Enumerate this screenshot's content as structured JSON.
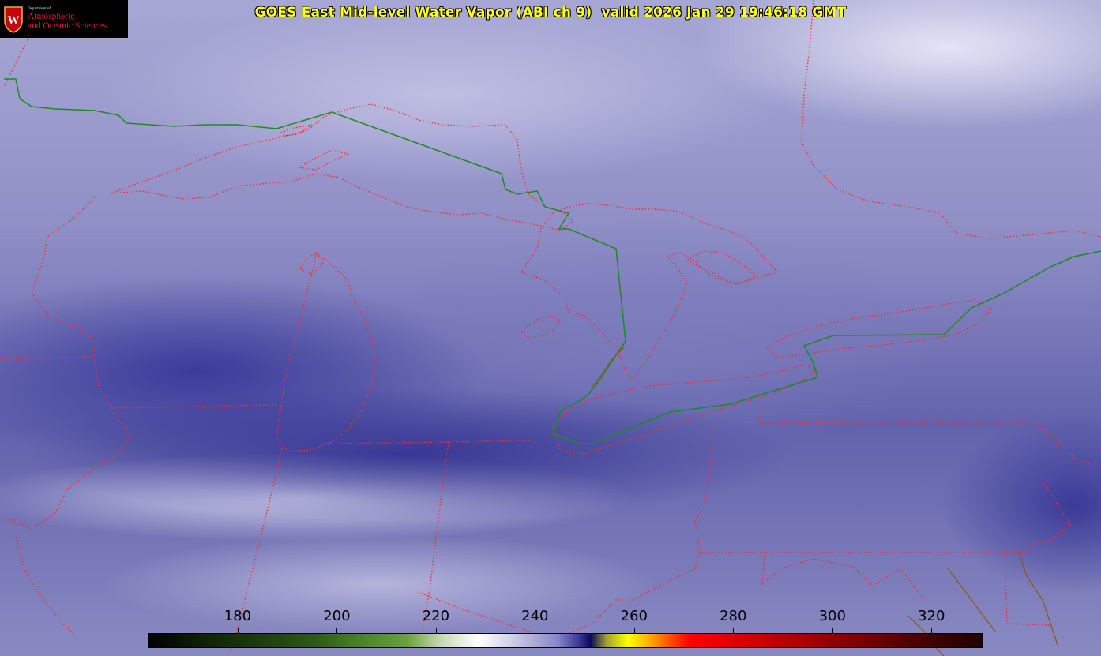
{
  "header": {
    "title": "GOES East Mid-level Water Vapor (ABI ch 9)  valid 2026 Jan 29 19:46:18 GMT"
  },
  "logo": {
    "department": "Department of",
    "line1": "Atmospheric",
    "line2": "and Oceanic Sciences",
    "icon": "uw-crest-icon"
  },
  "colorbar": {
    "ticks": [
      "180",
      "200",
      "220",
      "240",
      "260",
      "280",
      "300",
      "320"
    ],
    "tick_values": [
      180,
      200,
      220,
      240,
      260,
      280,
      300,
      320
    ],
    "range": [
      162,
      330
    ]
  },
  "colors": {
    "state_borders": "#ff2a2a",
    "international_border": "#1f8a1f",
    "coastline": "#6b5a20",
    "title_text": "#ffff1e",
    "logo_text": "#e2133c"
  }
}
